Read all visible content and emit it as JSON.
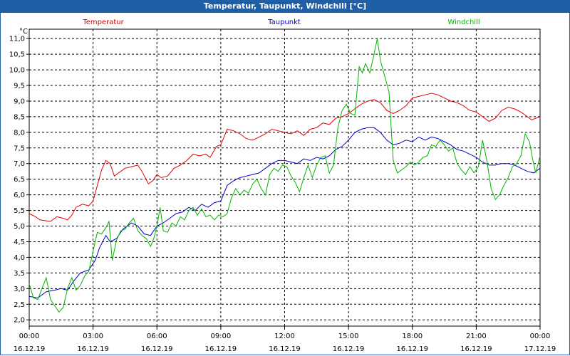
{
  "chart_data": {
    "type": "line",
    "title": "Temperatur, Taupunkt, Windchill [°C]",
    "ylabel": "°C",
    "ylim": [
      1.8,
      11.3
    ],
    "yticks": [
      "2,0",
      "2,5",
      "3,0",
      "3,5",
      "4,0",
      "4,5",
      "5,0",
      "5,5",
      "6,0",
      "6,5",
      "7,0",
      "7,5",
      "8,0",
      "8,5",
      "9,0",
      "9,5",
      "10,0",
      "10,5",
      "11,0"
    ],
    "ytick_values": [
      2.0,
      2.5,
      3.0,
      3.5,
      4.0,
      4.5,
      5.0,
      5.5,
      6.0,
      6.5,
      7.0,
      7.5,
      8.0,
      8.5,
      9.0,
      9.5,
      10.0,
      10.5,
      11.0
    ],
    "xlim": [
      0,
      24
    ],
    "xticks": [
      {
        "time": "00:00",
        "date": "16.12.19",
        "hour": 0
      },
      {
        "time": "03:00",
        "date": "16.12.19",
        "hour": 3
      },
      {
        "time": "06:00",
        "date": "16.12.19",
        "hour": 6
      },
      {
        "time": "09:00",
        "date": "16.12.19",
        "hour": 9
      },
      {
        "time": "12:00",
        "date": "16.12.19",
        "hour": 12
      },
      {
        "time": "15:00",
        "date": "16.12.19",
        "hour": 15
      },
      {
        "time": "18:00",
        "date": "16.12.19",
        "hour": 18
      },
      {
        "time": "21:00",
        "date": "16.12.19",
        "hour": 21
      },
      {
        "time": "00:00",
        "date": "17.12.19",
        "hour": 24
      }
    ],
    "grid": true,
    "legend": "top",
    "series": [
      {
        "name": "Temperatur",
        "color": "#e00000",
        "points": [
          [
            0,
            5.4
          ],
          [
            0.3,
            5.3
          ],
          [
            0.5,
            5.2
          ],
          [
            1,
            5.15
          ],
          [
            1.3,
            5.3
          ],
          [
            1.6,
            5.25
          ],
          [
            1.8,
            5.2
          ],
          [
            2,
            5.35
          ],
          [
            2.2,
            5.6
          ],
          [
            2.5,
            5.7
          ],
          [
            2.8,
            5.65
          ],
          [
            3,
            5.8
          ],
          [
            3.2,
            6.3
          ],
          [
            3.4,
            6.8
          ],
          [
            3.6,
            7.1
          ],
          [
            3.8,
            7.0
          ],
          [
            4,
            6.6
          ],
          [
            4.2,
            6.7
          ],
          [
            4.5,
            6.85
          ],
          [
            4.8,
            6.9
          ],
          [
            5.1,
            6.95
          ],
          [
            5.3,
            6.75
          ],
          [
            5.6,
            6.35
          ],
          [
            5.8,
            6.45
          ],
          [
            6,
            6.65
          ],
          [
            6.2,
            6.55
          ],
          [
            6.5,
            6.6
          ],
          [
            6.8,
            6.85
          ],
          [
            7.1,
            6.95
          ],
          [
            7.4,
            7.1
          ],
          [
            7.7,
            7.3
          ],
          [
            8,
            7.25
          ],
          [
            8.3,
            7.3
          ],
          [
            8.5,
            7.2
          ],
          [
            8.8,
            7.55
          ],
          [
            9,
            7.6
          ],
          [
            9.3,
            8.1
          ],
          [
            9.6,
            8.05
          ],
          [
            9.9,
            7.95
          ],
          [
            10.2,
            7.8
          ],
          [
            10.5,
            7.75
          ],
          [
            10.8,
            7.85
          ],
          [
            11.1,
            7.95
          ],
          [
            11.4,
            8.1
          ],
          [
            11.7,
            8.05
          ],
          [
            12,
            8.0
          ],
          [
            12.3,
            7.95
          ],
          [
            12.6,
            8.05
          ],
          [
            12.9,
            7.9
          ],
          [
            13.2,
            8.1
          ],
          [
            13.5,
            8.15
          ],
          [
            13.8,
            8.3
          ],
          [
            14.1,
            8.25
          ],
          [
            14.4,
            8.45
          ],
          [
            14.7,
            8.5
          ],
          [
            15,
            8.6
          ],
          [
            15.3,
            8.75
          ],
          [
            15.6,
            8.9
          ],
          [
            15.9,
            9.0
          ],
          [
            16.2,
            9.05
          ],
          [
            16.5,
            8.95
          ],
          [
            16.8,
            8.7
          ],
          [
            17.1,
            8.6
          ],
          [
            17.4,
            8.7
          ],
          [
            17.7,
            8.85
          ],
          [
            18,
            9.1
          ],
          [
            18.3,
            9.15
          ],
          [
            18.6,
            9.2
          ],
          [
            18.9,
            9.25
          ],
          [
            19.2,
            9.2
          ],
          [
            19.5,
            9.1
          ],
          [
            19.8,
            9.0
          ],
          [
            20.1,
            8.95
          ],
          [
            20.4,
            8.85
          ],
          [
            20.7,
            8.7
          ],
          [
            21,
            8.65
          ],
          [
            21.3,
            8.5
          ],
          [
            21.6,
            8.35
          ],
          [
            21.9,
            8.45
          ],
          [
            22.2,
            8.7
          ],
          [
            22.5,
            8.8
          ],
          [
            22.8,
            8.75
          ],
          [
            23.1,
            8.65
          ],
          [
            23.4,
            8.5
          ],
          [
            23.6,
            8.4
          ],
          [
            24,
            8.5
          ]
        ]
      },
      {
        "name": "Taupunkt",
        "color": "#0000c8",
        "points": [
          [
            0,
            2.75
          ],
          [
            0.4,
            2.7
          ],
          [
            0.8,
            2.9
          ],
          [
            1.2,
            2.95
          ],
          [
            1.5,
            3.0
          ],
          [
            1.8,
            2.95
          ],
          [
            2.1,
            3.25
          ],
          [
            2.4,
            3.5
          ],
          [
            2.8,
            3.6
          ],
          [
            3.1,
            3.9
          ],
          [
            3.3,
            4.3
          ],
          [
            3.6,
            4.7
          ],
          [
            3.8,
            4.5
          ],
          [
            4.1,
            4.6
          ],
          [
            4.4,
            4.9
          ],
          [
            4.8,
            5.1
          ],
          [
            5.1,
            5.0
          ],
          [
            5.4,
            4.75
          ],
          [
            5.7,
            4.7
          ],
          [
            6,
            5.0
          ],
          [
            6.3,
            5.1
          ],
          [
            6.6,
            5.25
          ],
          [
            6.9,
            5.4
          ],
          [
            7.2,
            5.45
          ],
          [
            7.5,
            5.6
          ],
          [
            7.8,
            5.5
          ],
          [
            8.1,
            5.7
          ],
          [
            8.4,
            5.6
          ],
          [
            8.7,
            5.75
          ],
          [
            9,
            5.8
          ],
          [
            9.3,
            6.3
          ],
          [
            9.6,
            6.45
          ],
          [
            9.9,
            6.55
          ],
          [
            10.2,
            6.6
          ],
          [
            10.5,
            6.65
          ],
          [
            10.8,
            6.7
          ],
          [
            11.1,
            6.85
          ],
          [
            11.4,
            7.0
          ],
          [
            11.7,
            7.1
          ],
          [
            12,
            7.1
          ],
          [
            12.3,
            7.05
          ],
          [
            12.6,
            7.0
          ],
          [
            12.9,
            7.15
          ],
          [
            13.2,
            7.1
          ],
          [
            13.5,
            7.2
          ],
          [
            13.8,
            7.15
          ],
          [
            14.1,
            7.25
          ],
          [
            14.4,
            7.45
          ],
          [
            14.7,
            7.55
          ],
          [
            15,
            7.75
          ],
          [
            15.3,
            8.0
          ],
          [
            15.6,
            8.1
          ],
          [
            15.9,
            8.15
          ],
          [
            16.2,
            8.15
          ],
          [
            16.5,
            8.0
          ],
          [
            16.8,
            7.75
          ],
          [
            17.1,
            7.6
          ],
          [
            17.4,
            7.65
          ],
          [
            17.7,
            7.75
          ],
          [
            18,
            7.7
          ],
          [
            18.3,
            7.85
          ],
          [
            18.6,
            7.75
          ],
          [
            18.9,
            7.85
          ],
          [
            19.2,
            7.8
          ],
          [
            19.5,
            7.7
          ],
          [
            19.8,
            7.6
          ],
          [
            20.1,
            7.45
          ],
          [
            20.4,
            7.4
          ],
          [
            20.7,
            7.3
          ],
          [
            21,
            7.2
          ],
          [
            21.3,
            7.05
          ],
          [
            21.6,
            6.95
          ],
          [
            21.9,
            6.95
          ],
          [
            22.2,
            7.0
          ],
          [
            22.5,
            7.0
          ],
          [
            22.8,
            6.95
          ],
          [
            23.1,
            6.85
          ],
          [
            23.4,
            6.75
          ],
          [
            23.7,
            6.7
          ],
          [
            24,
            6.85
          ]
        ]
      },
      {
        "name": "Windchill",
        "color": "#00b400",
        "points": [
          [
            0,
            3.15
          ],
          [
            0.2,
            2.7
          ],
          [
            0.4,
            2.65
          ],
          [
            0.6,
            3.0
          ],
          [
            0.8,
            3.35
          ],
          [
            1,
            2.65
          ],
          [
            1.2,
            2.45
          ],
          [
            1.4,
            2.25
          ],
          [
            1.6,
            2.4
          ],
          [
            1.8,
            3.0
          ],
          [
            2,
            3.35
          ],
          [
            2.2,
            2.95
          ],
          [
            2.4,
            3.1
          ],
          [
            2.6,
            3.4
          ],
          [
            2.8,
            3.55
          ],
          [
            3,
            4.2
          ],
          [
            3.2,
            4.8
          ],
          [
            3.4,
            4.75
          ],
          [
            3.6,
            4.95
          ],
          [
            3.75,
            5.15
          ],
          [
            3.9,
            3.9
          ],
          [
            4.1,
            4.55
          ],
          [
            4.3,
            4.85
          ],
          [
            4.5,
            4.9
          ],
          [
            4.7,
            5.1
          ],
          [
            4.9,
            5.25
          ],
          [
            5.1,
            4.85
          ],
          [
            5.3,
            4.7
          ],
          [
            5.5,
            4.6
          ],
          [
            5.7,
            4.35
          ],
          [
            5.85,
            4.6
          ],
          [
            6,
            5.0
          ],
          [
            6.15,
            5.6
          ],
          [
            6.3,
            4.85
          ],
          [
            6.5,
            4.8
          ],
          [
            6.7,
            5.1
          ],
          [
            6.9,
            5.0
          ],
          [
            7.1,
            5.3
          ],
          [
            7.3,
            5.2
          ],
          [
            7.5,
            5.5
          ],
          [
            7.7,
            5.6
          ],
          [
            7.9,
            5.35
          ],
          [
            8.1,
            5.55
          ],
          [
            8.3,
            5.3
          ],
          [
            8.5,
            5.35
          ],
          [
            8.7,
            5.2
          ],
          [
            8.9,
            5.35
          ],
          [
            9.1,
            5.3
          ],
          [
            9.3,
            5.4
          ],
          [
            9.5,
            5.9
          ],
          [
            9.7,
            6.2
          ],
          [
            9.9,
            6.0
          ],
          [
            10.1,
            6.15
          ],
          [
            10.3,
            6.05
          ],
          [
            10.5,
            6.35
          ],
          [
            10.7,
            6.5
          ],
          [
            10.9,
            6.2
          ],
          [
            11.1,
            6.0
          ],
          [
            11.3,
            6.65
          ],
          [
            11.5,
            6.85
          ],
          [
            11.7,
            6.75
          ],
          [
            11.9,
            6.95
          ],
          [
            12.1,
            6.9
          ],
          [
            12.3,
            6.6
          ],
          [
            12.5,
            6.4
          ],
          [
            12.7,
            6.1
          ],
          [
            12.9,
            6.55
          ],
          [
            13.1,
            6.95
          ],
          [
            13.3,
            6.55
          ],
          [
            13.5,
            6.95
          ],
          [
            13.7,
            7.2
          ],
          [
            13.9,
            7.25
          ],
          [
            14.1,
            6.7
          ],
          [
            14.3,
            6.95
          ],
          [
            14.5,
            8.15
          ],
          [
            14.7,
            8.7
          ],
          [
            14.9,
            8.9
          ],
          [
            15.1,
            8.6
          ],
          [
            15.3,
            8.55
          ],
          [
            15.5,
            10.1
          ],
          [
            15.65,
            9.9
          ],
          [
            15.8,
            10.2
          ],
          [
            16,
            9.9
          ],
          [
            16.2,
            10.5
          ],
          [
            16.35,
            11.0
          ],
          [
            16.5,
            10.3
          ],
          [
            16.7,
            9.8
          ],
          [
            16.9,
            9.3
          ],
          [
            17.1,
            7.1
          ],
          [
            17.3,
            6.7
          ],
          [
            17.5,
            6.8
          ],
          [
            17.7,
            6.9
          ],
          [
            17.9,
            7.05
          ],
          [
            18.1,
            6.95
          ],
          [
            18.3,
            7.05
          ],
          [
            18.5,
            7.2
          ],
          [
            18.7,
            7.25
          ],
          [
            18.9,
            7.6
          ],
          [
            19.1,
            7.55
          ],
          [
            19.3,
            7.75
          ],
          [
            19.5,
            7.6
          ],
          [
            19.7,
            7.4
          ],
          [
            19.9,
            7.5
          ],
          [
            20.1,
            7.0
          ],
          [
            20.3,
            6.8
          ],
          [
            20.5,
            6.65
          ],
          [
            20.7,
            6.9
          ],
          [
            20.9,
            6.7
          ],
          [
            21.1,
            6.9
          ],
          [
            21.3,
            7.75
          ],
          [
            21.5,
            7.1
          ],
          [
            21.7,
            6.2
          ],
          [
            21.9,
            5.85
          ],
          [
            22.1,
            6.0
          ],
          [
            22.3,
            6.3
          ],
          [
            22.5,
            6.55
          ],
          [
            22.7,
            6.9
          ],
          [
            22.9,
            7.0
          ],
          [
            23.1,
            7.25
          ],
          [
            23.3,
            7.95
          ],
          [
            23.5,
            7.7
          ],
          [
            23.65,
            7.15
          ],
          [
            23.8,
            6.7
          ],
          [
            24,
            7.25
          ]
        ]
      }
    ]
  }
}
